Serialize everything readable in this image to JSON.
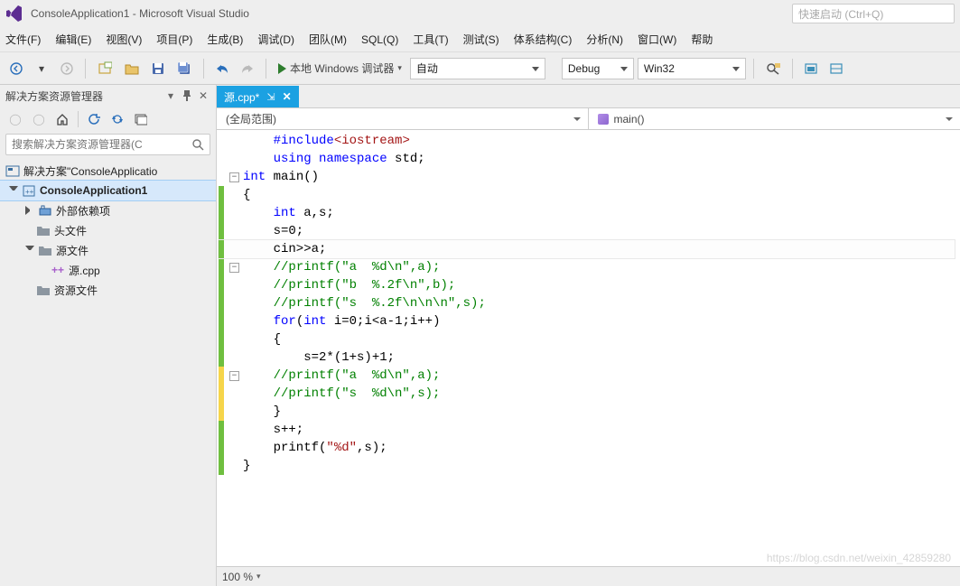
{
  "title_bar": {
    "title": "ConsoleApplication1 - Microsoft Visual Studio"
  },
  "quick_launch": {
    "placeholder": "快速启动 (Ctrl+Q)"
  },
  "menus": [
    "文件(F)",
    "编辑(E)",
    "视图(V)",
    "项目(P)",
    "生成(B)",
    "调试(D)",
    "团队(M)",
    "SQL(Q)",
    "工具(T)",
    "测试(S)",
    "体系结构(C)",
    "分析(N)",
    "窗口(W)",
    "帮助"
  ],
  "toolbar": {
    "run_label": "本地 Windows 调试器",
    "launch_mode": "自动",
    "config": "Debug",
    "platform": "Win32"
  },
  "sidebar": {
    "header": "解决方案资源管理器",
    "search_placeholder": "搜索解决方案资源管理器(C",
    "tree": {
      "solution_label": "解决方案\"ConsoleApplicatio",
      "project_label": "ConsoleApplication1",
      "ext_deps": "外部依赖项",
      "headers": "头文件",
      "sources": "源文件",
      "source_file": "源.cpp",
      "resources": "资源文件"
    }
  },
  "editor": {
    "tab_label": "源.cpp*",
    "scope_left": "(全局范围)",
    "scope_right": "main()",
    "zoom": "100 %",
    "code_lines": [
      {
        "mark": "",
        "fold": "",
        "segs": [
          {
            "t": "    ",
            "c": ""
          },
          {
            "t": "#include",
            "c": "kw"
          },
          {
            "t": "<iostream>",
            "c": "ang"
          }
        ]
      },
      {
        "mark": "",
        "fold": "",
        "segs": [
          {
            "t": "    ",
            "c": ""
          },
          {
            "t": "using namespace",
            "c": "kw"
          },
          {
            "t": " std;",
            "c": ""
          }
        ]
      },
      {
        "mark": "",
        "fold": "-",
        "segs": [
          {
            "t": "int",
            "c": "kw"
          },
          {
            "t": " main()",
            "c": ""
          }
        ]
      },
      {
        "mark": "g",
        "fold": "",
        "segs": [
          {
            "t": "{",
            "c": ""
          }
        ]
      },
      {
        "mark": "g",
        "fold": "",
        "segs": [
          {
            "t": "    ",
            "c": ""
          },
          {
            "t": "int",
            "c": "kw"
          },
          {
            "t": " a,s;",
            "c": ""
          }
        ]
      },
      {
        "mark": "g",
        "fold": "",
        "segs": [
          {
            "t": "    s=0;",
            "c": ""
          }
        ]
      },
      {
        "mark": "g",
        "fold": "",
        "cur": true,
        "segs": [
          {
            "t": "    cin>>a;",
            "c": ""
          }
        ]
      },
      {
        "mark": "g",
        "fold": "-",
        "segs": [
          {
            "t": "    ",
            "c": ""
          },
          {
            "t": "//printf(\"a  %d\\n\",a);",
            "c": "cm"
          }
        ]
      },
      {
        "mark": "g",
        "fold": "",
        "segs": [
          {
            "t": "    ",
            "c": ""
          },
          {
            "t": "//printf(\"b  %.2f\\n\",b);",
            "c": "cm"
          }
        ]
      },
      {
        "mark": "g",
        "fold": "",
        "segs": [
          {
            "t": "    ",
            "c": ""
          },
          {
            "t": "//printf(\"s  %.2f\\n\\n\\n\",s);",
            "c": "cm"
          }
        ]
      },
      {
        "mark": "g",
        "fold": "",
        "segs": [
          {
            "t": "    ",
            "c": ""
          },
          {
            "t": "for",
            "c": "kw"
          },
          {
            "t": "(",
            "c": ""
          },
          {
            "t": "int",
            "c": "kw"
          },
          {
            "t": " i=0;i<a-1;i++)",
            "c": ""
          }
        ]
      },
      {
        "mark": "g",
        "fold": "",
        "segs": [
          {
            "t": "    {",
            "c": ""
          }
        ]
      },
      {
        "mark": "g",
        "fold": "",
        "segs": [
          {
            "t": "        s=2*(1+s)+1;",
            "c": ""
          }
        ]
      },
      {
        "mark": "y",
        "fold": "-",
        "segs": [
          {
            "t": "    ",
            "c": ""
          },
          {
            "t": "//printf(\"a  %d\\n\",a);",
            "c": "cm"
          }
        ]
      },
      {
        "mark": "y",
        "fold": "",
        "segs": [
          {
            "t": "    ",
            "c": ""
          },
          {
            "t": "//printf(\"s  %d\\n\",s);",
            "c": "cm"
          }
        ]
      },
      {
        "mark": "y",
        "fold": "",
        "segs": [
          {
            "t": "    }",
            "c": ""
          }
        ]
      },
      {
        "mark": "g",
        "fold": "",
        "segs": [
          {
            "t": "    s++;",
            "c": ""
          }
        ]
      },
      {
        "mark": "g",
        "fold": "",
        "segs": [
          {
            "t": "    printf(",
            "c": ""
          },
          {
            "t": "\"%d\"",
            "c": "str"
          },
          {
            "t": ",s);",
            "c": ""
          }
        ]
      },
      {
        "mark": "g",
        "fold": "",
        "segs": [
          {
            "t": "}",
            "c": ""
          }
        ]
      }
    ]
  },
  "watermark": "https://blog.csdn.net/weixin_42859280"
}
